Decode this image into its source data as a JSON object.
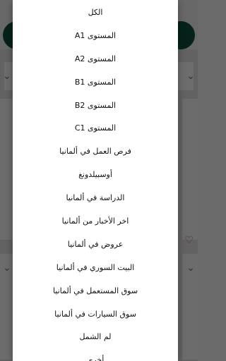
{
  "dialog": {
    "items": [
      {
        "label": "الكل"
      },
      {
        "label": "المستوى A1"
      },
      {
        "label": "المستوى A2"
      },
      {
        "label": "المستوى B1"
      },
      {
        "label": "المستوى B2"
      },
      {
        "label": "المستوى C1"
      },
      {
        "label": "فرص العمل في ألمانيا"
      },
      {
        "label": "أوسبيلدونغ"
      },
      {
        "label": "الدراسة في ألمانيا"
      },
      {
        "label": "اخر الأخبار من ألمانيا"
      },
      {
        "label": "عروض في ألمانيا"
      },
      {
        "label": "البيت السوري في ألمانيا"
      },
      {
        "label": "سوق المستعمل في ألمانيا"
      },
      {
        "label": "سوق السيارات في ألمانيا"
      },
      {
        "label": "لم الشمل"
      },
      {
        "label": "أخرى"
      }
    ]
  }
}
